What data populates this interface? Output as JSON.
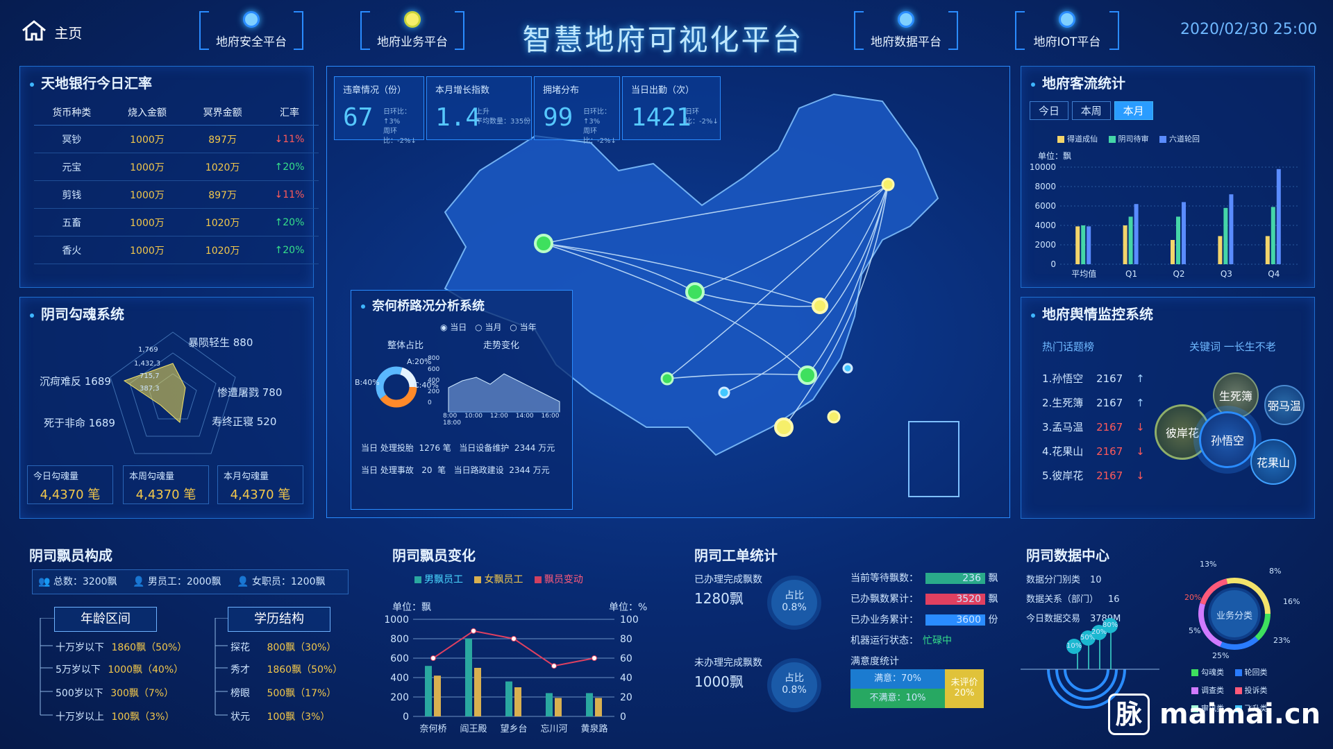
{
  "header": {
    "home_label": "主页",
    "title": "智慧地府可视化平台",
    "datetime": "2020/02/30 25:00",
    "nav": [
      "地府安全平台",
      "地府业务平台",
      "地府数据平台",
      "地府IOT平台"
    ]
  },
  "exchange": {
    "title": "天地银行今日汇率",
    "headers": [
      "货币种类",
      "烧入金额",
      "冥界金额",
      "汇率"
    ],
    "rows": [
      {
        "type": "冥钞",
        "burn": "1000万",
        "hell": "897万",
        "rate": "↓11%",
        "dir": "down"
      },
      {
        "type": "元宝",
        "burn": "1000万",
        "hell": "1020万",
        "rate": "↑20%",
        "dir": "up"
      },
      {
        "type": "剪钱",
        "burn": "1000万",
        "hell": "897万",
        "rate": "↓11%",
        "dir": "down"
      },
      {
        "type": "五畜",
        "burn": "1000万",
        "hell": "1020万",
        "rate": "↑20%",
        "dir": "up"
      },
      {
        "type": "香火",
        "burn": "1000万",
        "hell": "1020万",
        "rate": "↑20%",
        "dir": "up"
      }
    ]
  },
  "soul": {
    "title": "阴司勾魂系统",
    "radar_labels": [
      "暴陨轻生 880",
      "惨遭屠戮 780",
      "寿终正寝 520",
      "死于非命 1689",
      "沉疴难反 1689"
    ],
    "radar_ticks": [
      "1,769",
      "1,432,3",
      "715,7",
      "387,3"
    ],
    "stats": [
      {
        "label": "今日勾魂量",
        "value": "4,4370 笔"
      },
      {
        "label": "本周勾魂量",
        "value": "4,4370 笔"
      },
      {
        "label": "本月勾魂量",
        "value": "4,4370 笔"
      }
    ]
  },
  "kpis": [
    {
      "title": "违章情况（份）",
      "value": "67",
      "sub1": "日环比：↑3%",
      "sub2": "周环比：-2%↓"
    },
    {
      "title": "本月增长指数",
      "value": "1.4",
      "sub1": "上升",
      "sub2": "平均数量：335份"
    },
    {
      "title": "拥堵分布",
      "value": "99",
      "sub1": "日环比：↑3%",
      "sub2": "周环比：-2%↓"
    },
    {
      "title": "当日出勤（次）",
      "value": "1421",
      "sub1": "日环比：-2%↓",
      "sub2": ""
    }
  ],
  "bridge": {
    "title": "奈何桥路况分析系统",
    "radio": [
      "当日",
      "当月",
      "当年"
    ],
    "ring_title": "整体占比",
    "ring_labels": [
      "A:20%",
      "B:40%",
      "C:40%"
    ],
    "trend_title": "走势变化",
    "trend_y": [
      "800",
      "600",
      "400",
      "200",
      "0"
    ],
    "trend_x": [
      "8:00",
      "10:00",
      "12:00",
      "14:00",
      "16:00",
      "18:00"
    ],
    "footer1": "当日 处理投胎  1276 笔   当日设备维护  2344 万元",
    "footer2": "当日 处理事故   20  笔   当日路政建设  2344 万元"
  },
  "visitor": {
    "title": "地府客流统计",
    "tabs": [
      "今日",
      "本周",
      "本月"
    ],
    "legend": [
      "得道成仙",
      "阴司待审",
      "六道轮回"
    ],
    "unit": "单位：飘",
    "chart_data": {
      "type": "bar",
      "categories": [
        "平均值",
        "Q1",
        "Q2",
        "Q3",
        "Q4"
      ],
      "series": [
        {
          "name": "得道成仙",
          "values": [
            3900,
            4000,
            2500,
            2900,
            2900
          ]
        },
        {
          "name": "阴司待审",
          "values": [
            4000,
            4900,
            4900,
            5800,
            5900
          ]
        },
        {
          "name": "六道轮回",
          "values": [
            3900,
            6200,
            6400,
            7200,
            9800
          ]
        }
      ],
      "ylim": [
        0,
        10000
      ],
      "yticks": [
        "10000",
        "8000",
        "6000",
        "4000",
        "2000",
        "0"
      ]
    }
  },
  "sentiment": {
    "title": "地府舆情监控系统",
    "hot_title": "热门话题榜",
    "keyword": "关键词 一长生不老",
    "hot": [
      {
        "name": "1.孙悟空",
        "val": "2167",
        "arrow": "↑",
        "dir": "up"
      },
      {
        "name": "2.生死簿",
        "val": "2167",
        "arrow": "↑",
        "dir": "up"
      },
      {
        "name": "3.孟马温",
        "val": "2167",
        "arrow": "↓",
        "dir": "down"
      },
      {
        "name": "4.花果山",
        "val": "2167",
        "arrow": "↓",
        "dir": "down"
      },
      {
        "name": "5.彼岸花",
        "val": "2167",
        "arrow": "↓",
        "dir": "down"
      }
    ],
    "bubbles": [
      "生死簿",
      "弼马温",
      "彼岸花",
      "孙悟空",
      "花果山"
    ]
  },
  "staff": {
    "title": "阴司飘员构成",
    "total": "总数：3200飘",
    "male": "男员工：2000飘",
    "female": "女职员：1200飘",
    "age_title": "年龄区间",
    "edu_title": "学历结构",
    "ages": [
      {
        "label": "十万岁以下",
        "val": "1860飘（50%）"
      },
      {
        "label": "5万岁以下",
        "val": "1000飘（40%）"
      },
      {
        "label": "500岁以下",
        "val": "300飘（7%）"
      },
      {
        "label": "十万岁以上",
        "val": "100飘（3%）"
      }
    ],
    "edu": [
      {
        "label": "探花",
        "val": "800飘（30%）"
      },
      {
        "label": "秀才",
        "val": "1860飘（50%）"
      },
      {
        "label": "榜眼",
        "val": "500飘（17%）"
      },
      {
        "label": "状元",
        "val": "100飘（3%）"
      }
    ]
  },
  "change": {
    "title": "阴司飘员变化",
    "legend": [
      "男飘员工",
      "女飘员工",
      "飘员变动"
    ],
    "unit_left": "单位：飘",
    "unit_right": "单位：%",
    "chart_data": {
      "type": "bar",
      "categories": [
        "奈何桥",
        "阎王殿",
        "望乡台",
        "忘川河",
        "黄泉路"
      ],
      "series": [
        {
          "name": "男飘员工",
          "values": [
            520,
            800,
            360,
            240,
            240
          ]
        },
        {
          "name": "女飘员工",
          "values": [
            420,
            500,
            300,
            190,
            190
          ]
        },
        {
          "name": "飘员变动",
          "values": [
            60,
            88,
            80,
            52,
            60
          ]
        }
      ],
      "ylim": [
        0,
        1000
      ],
      "y2lim": [
        0,
        100
      ],
      "yticks": [
        "1000",
        "800",
        "600",
        "400",
        "200",
        "0"
      ],
      "y2ticks": [
        "100",
        "80",
        "60",
        "40",
        "20",
        "0"
      ]
    }
  },
  "orders": {
    "title": "阴司工单统计",
    "done_label": "已办理完成飘数",
    "done_value": "1280飘",
    "done_ratio": "占比 0.8%",
    "undone_label": "未办理完成飘数",
    "undone_value": "1000飘",
    "undone_ratio": "占比 0.8%",
    "waiting": {
      "label": "当前等待飘数：",
      "value": "236",
      "unit": "飘"
    },
    "done_total": {
      "label": "已办飘数累计：",
      "value": "3520",
      "unit": "飘"
    },
    "biz_total": {
      "label": "已办业务累计：",
      "value": "3600",
      "unit": "份"
    },
    "machine": {
      "label": "机器运行状态：",
      "value": "忙碌中"
    },
    "satisfaction_title": "满意度统计",
    "sat1": "满意：70%",
    "sat2": "不满意：10%",
    "sat3a": "未评价",
    "sat3b": "20%"
  },
  "datacenter": {
    "title": "阴司数据中心",
    "lines": [
      {
        "label": "数据分门别类",
        "val": "10"
      },
      {
        "label": "数据关系（部门）",
        "val": "16"
      },
      {
        "label": "今日数据交易",
        "val": "3789M"
      }
    ],
    "ring_center": "业务分类",
    "ring_pct": [
      "13%",
      "8%",
      "16%",
      "23%",
      "25%",
      "5%",
      "20%"
    ],
    "bar_pcts": [
      "10%",
      "50%",
      "20%",
      "80%"
    ],
    "legend": [
      "勾魂类",
      "轮回类",
      "调查类",
      "投诉类",
      "审讯类",
      "飞升类"
    ],
    "legend_colors": [
      "#3ee05e",
      "#2a7cff",
      "#d07aff",
      "#ff5a7a",
      "#a6ffda",
      "#42c7ff"
    ]
  },
  "watermark": "maimai.cn",
  "watermark_logo": "脉"
}
